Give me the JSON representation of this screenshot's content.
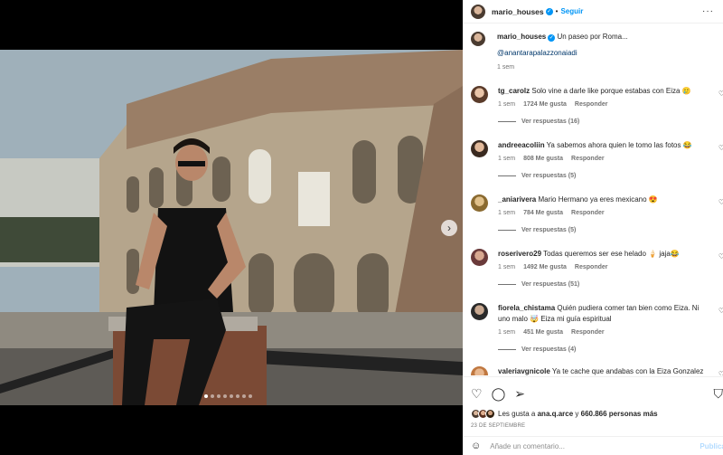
{
  "header": {
    "username": "mario_houses",
    "separator": "•",
    "follow_label": "Seguir",
    "more_icon": "more-horizontal-icon"
  },
  "caption": {
    "username": "mario_houses",
    "text": "Un paseo por Roma...",
    "mention": "@anantarapalazzonaiadi",
    "time": "1 sem"
  },
  "comments": [
    {
      "username": "tg_carolz",
      "text": "Solo vine a darle like porque estabas con Eiza 🥲",
      "time": "1 sem",
      "likes": "1724 Me gusta",
      "reply": "Responder",
      "view_replies": "Ver respuestas (16)"
    },
    {
      "username": "andreeacoliin",
      "text": "Ya sabemos ahora quien le tomo las fotos 😂",
      "time": "1 sem",
      "likes": "808 Me gusta",
      "reply": "Responder",
      "view_replies": "Ver respuestas (5)"
    },
    {
      "username": "_aniarivera",
      "text": "Mario Hermano ya eres mexicano 😍",
      "time": "1 sem",
      "likes": "784 Me gusta",
      "reply": "Responder",
      "view_replies": "Ver respuestas (5)"
    },
    {
      "username": "roserivero29",
      "text": "Todas queremos ser ese helado 🍦 jaja😂",
      "time": "1 sem",
      "likes": "1492 Me gusta",
      "reply": "Responder",
      "view_replies": "Ver respuestas (51)"
    },
    {
      "username": "fiorela_chistama",
      "text": "Quién pudiera comer tan bien como Eiza. Ni uno malo 🤯 Eiza mi guía espiritual",
      "time": "1 sem",
      "likes": "451 Me gusta",
      "reply": "Responder",
      "view_replies": "Ver respuestas (4)"
    },
    {
      "username": "valeriavgnicole",
      "text": "Ya te cache que andabas con la Eiza Gonzalez",
      "time": "",
      "likes": "",
      "reply": "",
      "view_replies": ""
    }
  ],
  "actions": {
    "like_icon": "heart-icon",
    "comment_icon": "comment-icon",
    "share_icon": "share-icon",
    "save_icon": "bookmark-icon"
  },
  "likes": {
    "prefix": "Les gusta a",
    "user": "ana.q.arce",
    "connector": "y",
    "others": "660.866 personas más"
  },
  "date": "23 DE SEPTIEMBRE",
  "add_comment": {
    "placeholder": "Añade un comentario...",
    "publish_label": "Publicar"
  },
  "carousel": {
    "current": 1,
    "total": 8
  }
}
